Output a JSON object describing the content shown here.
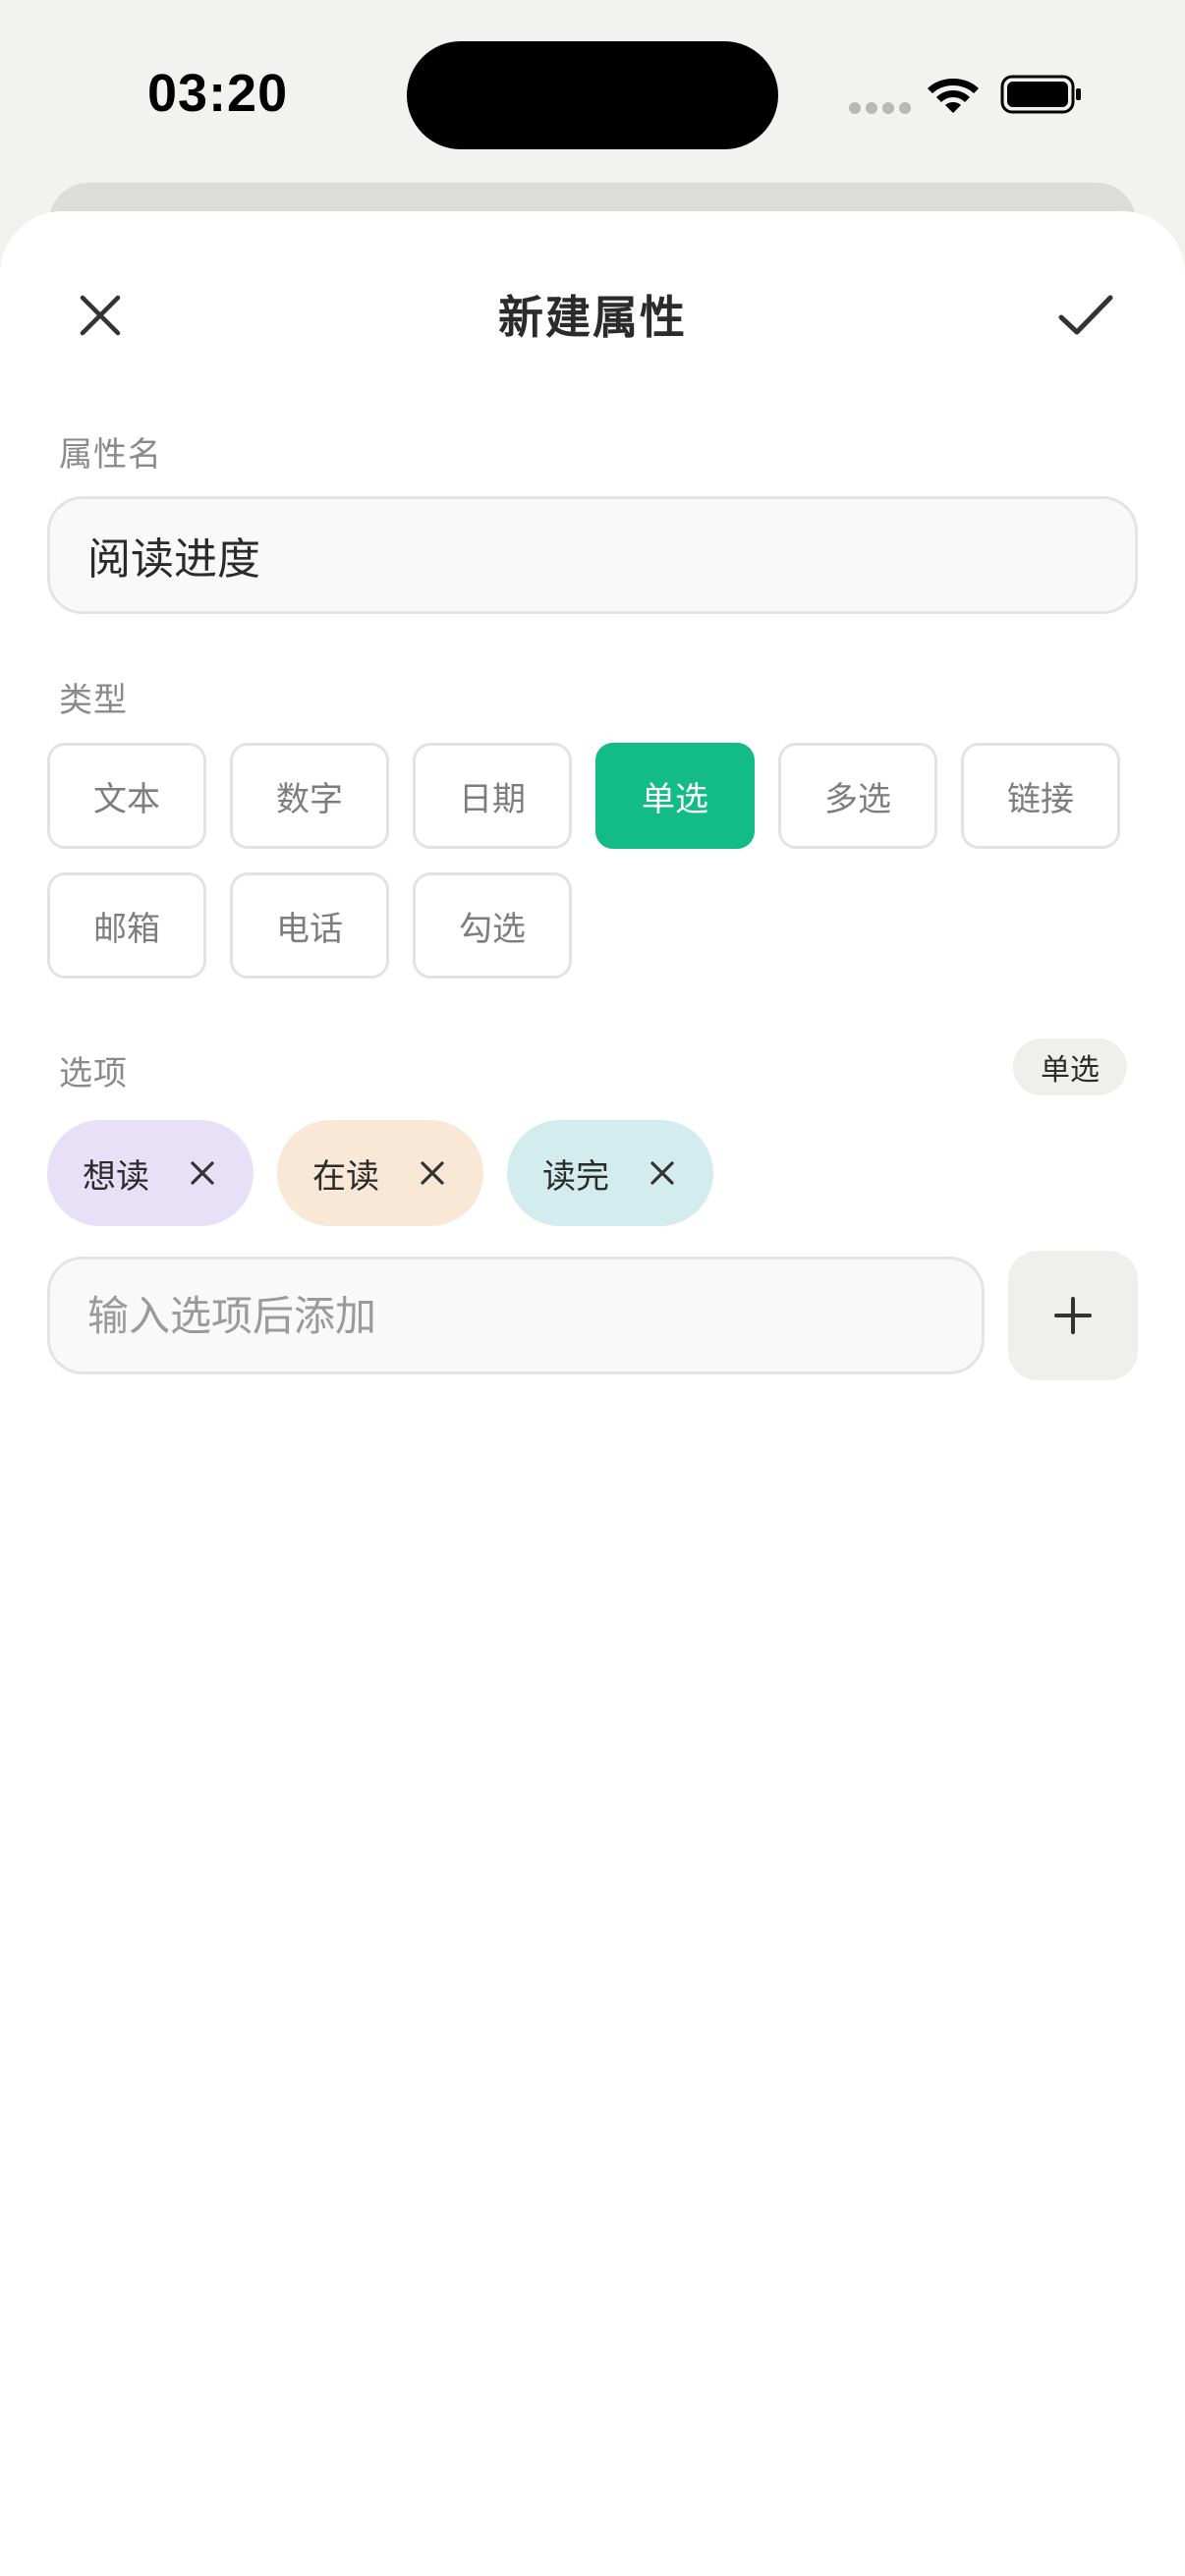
{
  "status_bar": {
    "time": "03:20",
    "icons": [
      "signal-icon",
      "wifi-icon",
      "battery-icon"
    ]
  },
  "header": {
    "title": "新建属性",
    "close_icon": "close-icon",
    "confirm_icon": "checkmark-icon"
  },
  "name_section": {
    "label": "属性名",
    "value": "阅读进度"
  },
  "type_section": {
    "label": "类型",
    "types": [
      "文本",
      "数字",
      "日期",
      "单选",
      "多选",
      "链接",
      "邮箱",
      "电话",
      "勾选"
    ],
    "selected": "单选"
  },
  "options_section": {
    "label": "选项",
    "mode_badge": "单选",
    "options": [
      {
        "label": "想读",
        "color": "#e8e0f6"
      },
      {
        "label": "在读",
        "color": "#f8e8d5"
      },
      {
        "label": "读完",
        "color": "#d3edef"
      }
    ],
    "input_placeholder": "输入选项后添加",
    "add_icon": "plus-icon"
  },
  "colors": {
    "accent": "#13bc84",
    "sheet_background": "#ffffff",
    "page_background": "#f2f2f1"
  }
}
